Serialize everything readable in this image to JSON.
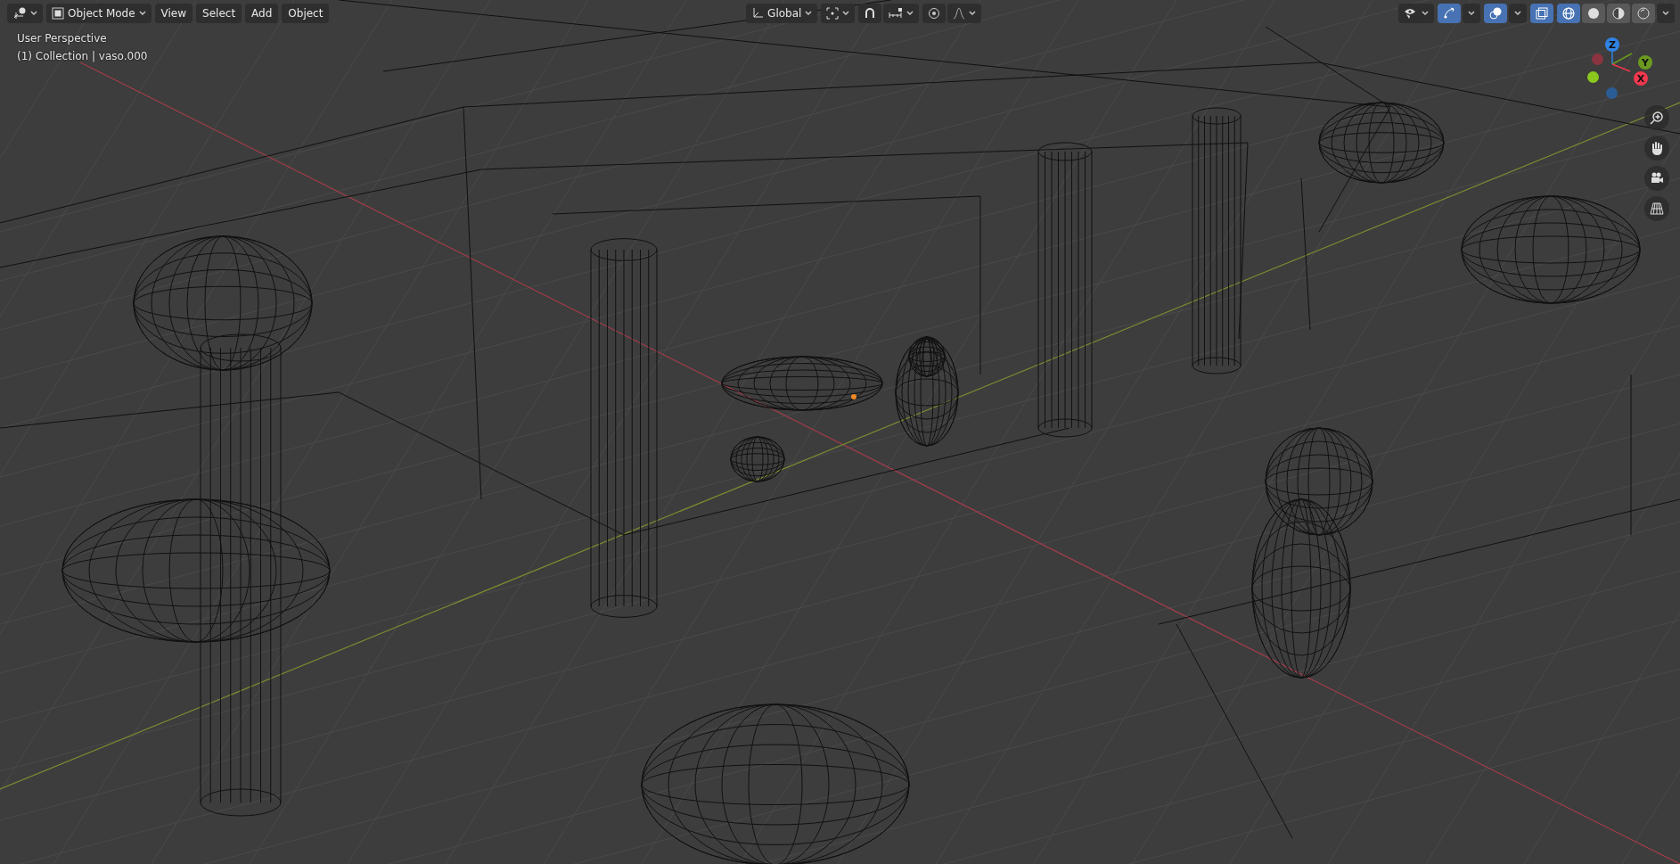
{
  "header": {
    "mode": "Object Mode",
    "menus": [
      "View",
      "Select",
      "Add",
      "Object"
    ],
    "orientation": "Global",
    "snap": {
      "on": false
    },
    "proportional": {
      "on": false
    },
    "visibility": {
      "on": false
    },
    "gizmos": {
      "on": true
    },
    "overlays": {
      "on": true
    },
    "xray": {
      "on": true
    },
    "shading": [
      {
        "kind": "wireframe",
        "selected": true
      },
      {
        "kind": "solid",
        "selected": false
      },
      {
        "kind": "material",
        "selected": false
      },
      {
        "kind": "rendered",
        "selected": false
      }
    ]
  },
  "info": {
    "view": "User Perspective",
    "object": "(1) Collection | vaso.000"
  },
  "axes": [
    {
      "label": "Z",
      "color": "#2f83e3"
    },
    {
      "label": "Y",
      "color": "#6a9a1f"
    },
    {
      "label": "X",
      "color": "#f0384e"
    }
  ]
}
